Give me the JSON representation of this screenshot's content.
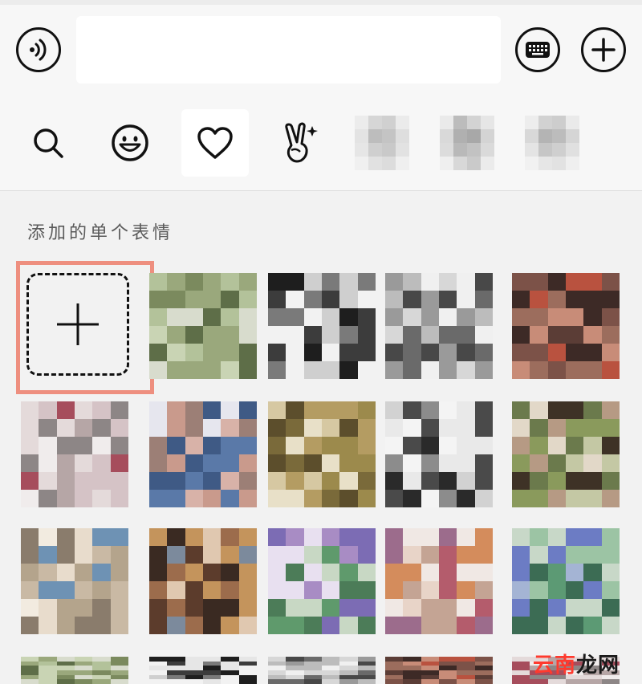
{
  "input_bar": {
    "voice_icon": "voice-icon",
    "text_value": "",
    "keyboard_icon": "keyboard-icon",
    "plus_icon": "plus-circle-icon"
  },
  "tabs": [
    {
      "icon": "search-icon",
      "active": false
    },
    {
      "icon": "smiley-icon",
      "active": false
    },
    {
      "icon": "heart-icon",
      "active": true
    },
    {
      "icon": "victory-hand-icon",
      "active": false
    },
    {
      "icon": "sticker-pack-icon",
      "active": false
    },
    {
      "icon": "sticker-pack-icon",
      "active": false
    },
    {
      "icon": "sticker-pack-icon",
      "active": false
    }
  ],
  "section": {
    "title": "添加的单个表情"
  },
  "add_tile": {
    "icon": "plus-icon",
    "highlight_color": "#ee8f7f"
  },
  "watermark": {
    "part1": "云南",
    "part2": "龙网"
  },
  "colors": {
    "background": "#f2f2f2",
    "bar": "#f7f7f7",
    "highlight": "#ee8f7f",
    "watermark": "#ff3a2e"
  }
}
